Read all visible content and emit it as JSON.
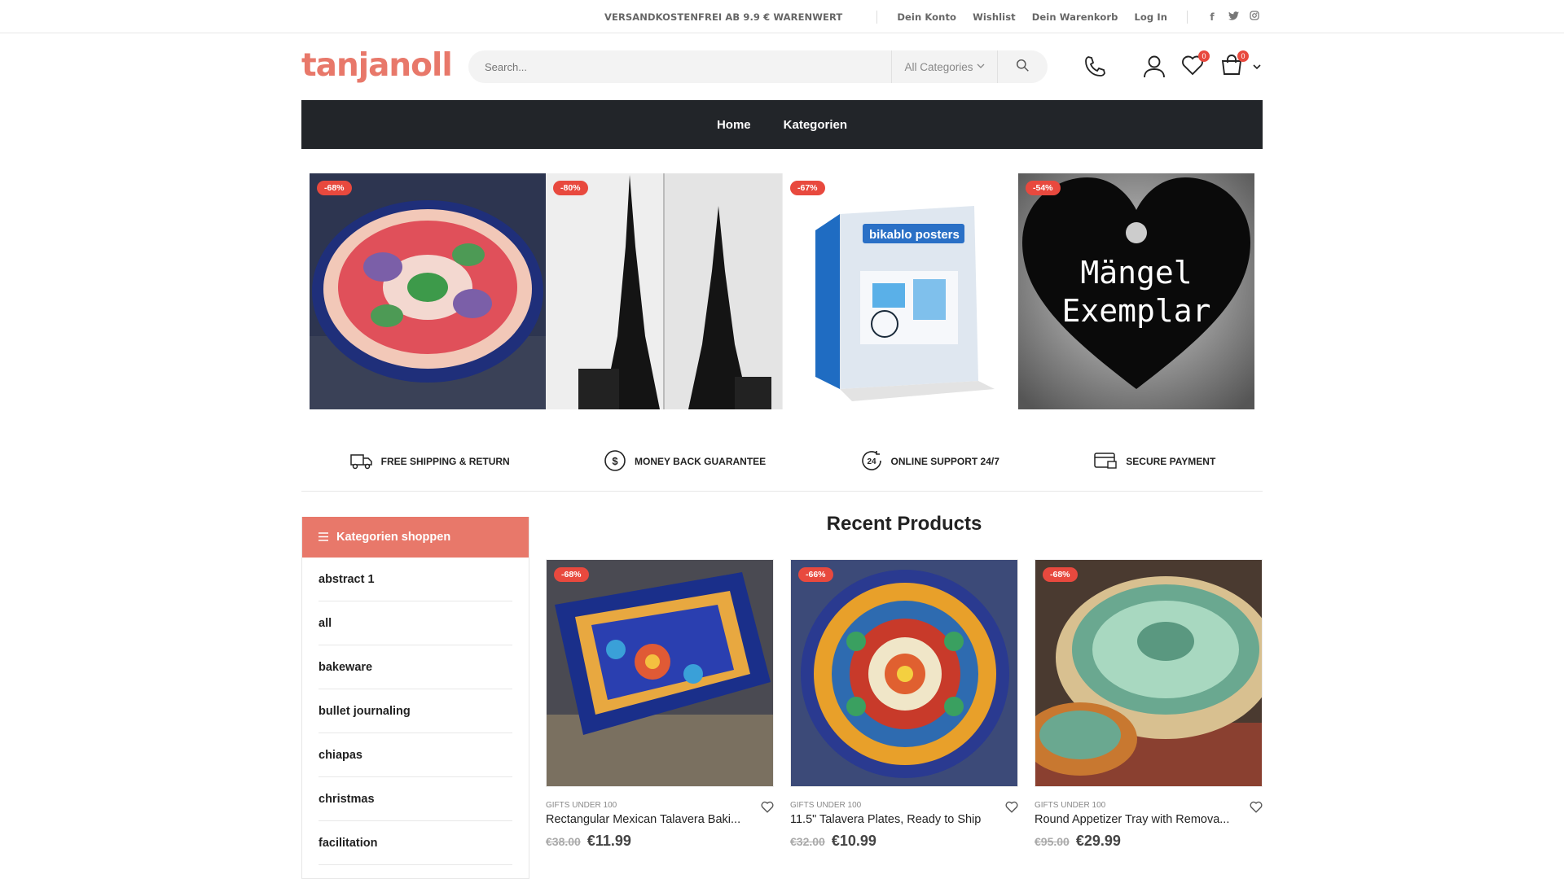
{
  "topbar": {
    "shipping": "VERSANDKOSTENFREI AB 9.9 € WARENWERT",
    "links": [
      "Dein Konto",
      "Wishlist",
      "Dein Warenkorb",
      "Log In"
    ],
    "social": [
      "facebook-icon",
      "twitter-icon",
      "instagram-icon"
    ]
  },
  "header": {
    "logo": "tanjanoll",
    "search_placeholder": "Search...",
    "category_select": "All Categories",
    "wishlist_count": "0",
    "cart_count": "0"
  },
  "nav": {
    "items": [
      "Home",
      "Kategorien"
    ]
  },
  "banners": [
    {
      "discount": "-68%"
    },
    {
      "discount": "-80%"
    },
    {
      "discount": "-67%",
      "brand": "bikablo posters"
    },
    {
      "discount": "-54%",
      "text_line1": "Mängel",
      "text_line2": "Exemplar"
    }
  ],
  "features": [
    {
      "icon": "truck-icon",
      "label": "FREE SHIPPING & RETURN"
    },
    {
      "icon": "dollar-circle-icon",
      "label": "MONEY BACK GUARANTEE"
    },
    {
      "icon": "support-24-icon",
      "label": "ONLINE SUPPORT 24/7"
    },
    {
      "icon": "card-icon",
      "label": "SECURE PAYMENT"
    }
  ],
  "sidebar": {
    "title": "Kategorien shoppen",
    "items": [
      "abstract 1",
      "all",
      "bakeware",
      "bullet journaling",
      "chiapas",
      "christmas",
      "facilitation"
    ]
  },
  "products": {
    "title": "Recent Products",
    "items": [
      {
        "discount": "-68%",
        "category": "GIFTS UNDER 100",
        "name": "Rectangular Mexican Talavera Baki...",
        "old_price": "€38.00",
        "price": "€11.99"
      },
      {
        "discount": "-66%",
        "category": "GIFTS UNDER 100",
        "name": "11.5\" Talavera Plates, Ready to Ship",
        "old_price": "€32.00",
        "price": "€10.99"
      },
      {
        "discount": "-68%",
        "category": "GIFTS UNDER 100",
        "name": "Round Appetizer Tray with Remova...",
        "old_price": "€95.00",
        "price": "€29.99"
      }
    ]
  },
  "colors": {
    "accent": "#e8786a",
    "nav_bg": "#222529",
    "badge": "#e8493e"
  }
}
